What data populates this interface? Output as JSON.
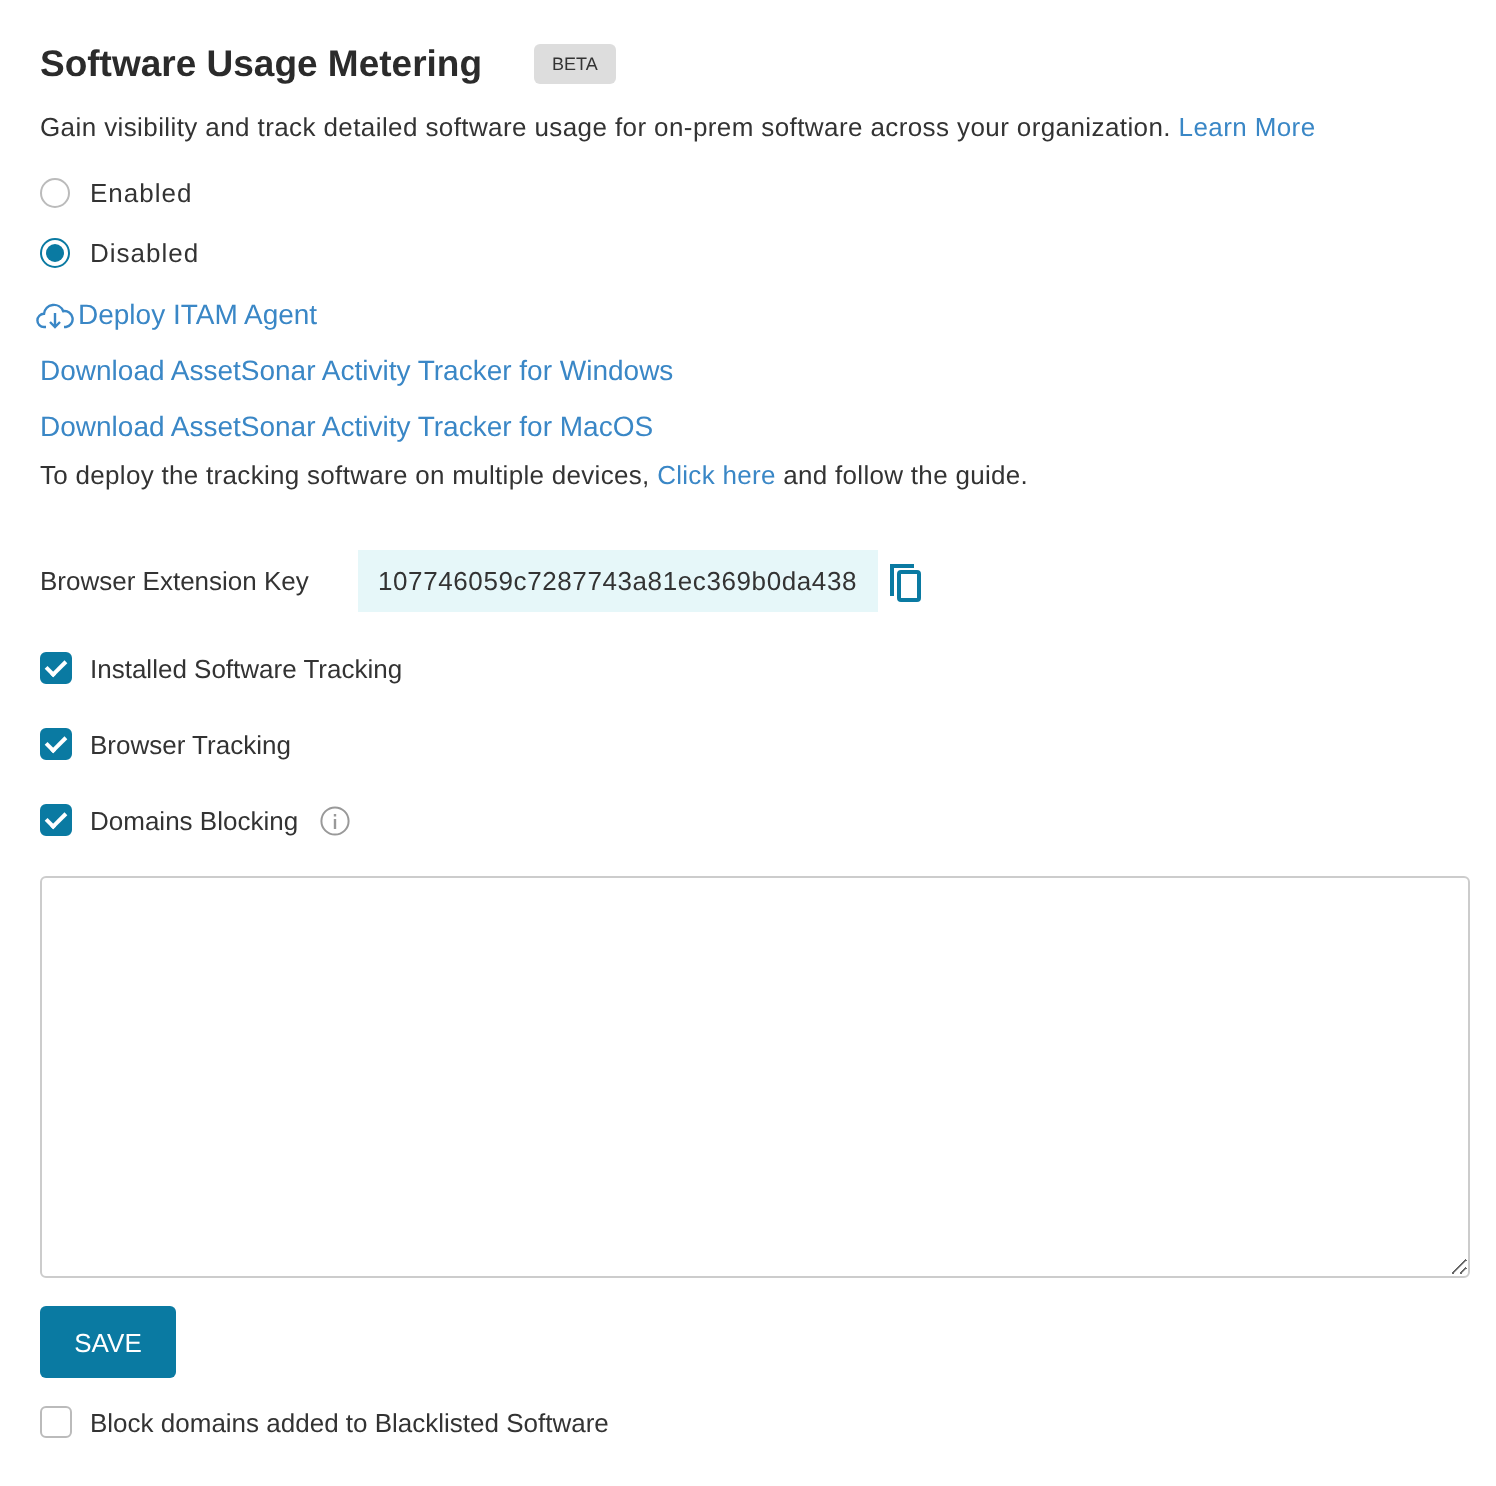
{
  "title": "Software Usage Metering",
  "badge": "BETA",
  "description": {
    "text": "Gain visibility and track detailed software usage for on-prem software across your organization.",
    "link": "Learn More"
  },
  "mode_options": [
    {
      "label": "Enabled",
      "selected": false
    },
    {
      "label": "Disabled",
      "selected": true
    }
  ],
  "deploy_link": "Deploy ITAM Agent",
  "download_links": [
    "Download AssetSonar Activity Tracker for Windows",
    "Download AssetSonar Activity Tracker for MacOS"
  ],
  "guide": {
    "before": "To deploy the tracking software on multiple devices,",
    "link": "Click here",
    "after": "and follow the guide."
  },
  "extension_key": {
    "label": "Browser Extension Key",
    "value": "107746059c7287743a81ec369b0da438"
  },
  "tracking_options": [
    {
      "label": "Installed Software Tracking",
      "checked": true,
      "info": false
    },
    {
      "label": "Browser Tracking",
      "checked": true,
      "info": false
    },
    {
      "label": "Domains Blocking",
      "checked": true,
      "info": true
    }
  ],
  "save_button": "SAVE",
  "block_option": {
    "label": "Block domains added to Blacklisted Software",
    "checked": false
  }
}
